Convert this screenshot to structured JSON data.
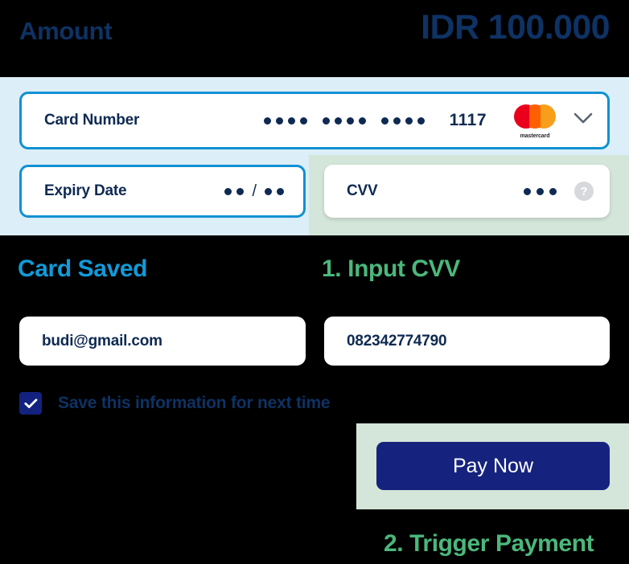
{
  "amount": {
    "label": "Amount",
    "value": "IDR 100.000"
  },
  "card_form": {
    "card_number": {
      "label": "Card Number",
      "masked_groups": [
        "••••",
        "••••",
        "••••"
      ],
      "last_four": "1117",
      "brand": "mastercard",
      "brand_text": "mastercard",
      "dropdown_icon": "chevron-down-icon"
    },
    "expiry": {
      "label": "Expiry Date",
      "month_mask": "••",
      "separator": "/",
      "year_mask": "••"
    },
    "cvv": {
      "label": "CVV",
      "mask": "•••",
      "help_icon": "question-mark-icon",
      "help_glyph": "?"
    }
  },
  "saved_section": {
    "card_saved_heading": "Card Saved",
    "input_cvv_heading": "1. Input CVV",
    "email_value": "budi@gmail.com",
    "phone_value": "082342774790",
    "save_checkbox": {
      "label": "Save this information for next time",
      "checked": true,
      "check_icon": "checkmark-icon"
    }
  },
  "payment": {
    "pay_button_label": "Pay Now",
    "trigger_payment_heading": "2. Trigger Payment"
  },
  "colors": {
    "navy_text": "#0E3263",
    "field_text": "#0E2A52",
    "active_border": "#0F91D2",
    "band_blue": "#DCEEF8",
    "band_green": "#D3E6D9",
    "heading_blue": "#119AD8",
    "heading_green": "#4BB77C",
    "button_navy": "#16237E",
    "checkbox_navy": "#13227E",
    "mastercard_red": "#EB001B",
    "mastercard_orange": "#F79E1B",
    "help_gray": "#D6D8DC",
    "background": "#000000"
  }
}
